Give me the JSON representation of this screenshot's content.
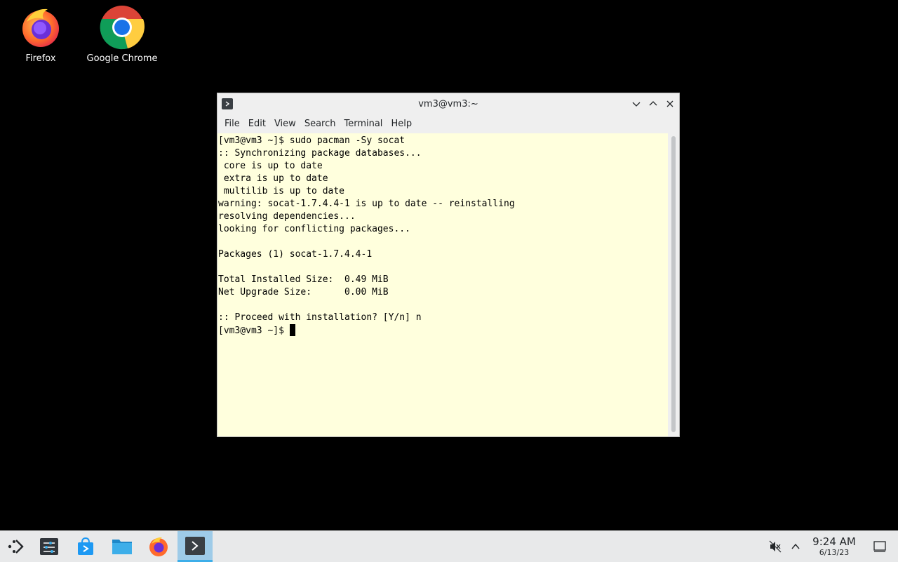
{
  "desktop": {
    "icons": [
      {
        "label": "Firefox",
        "icon": "firefox-icon"
      },
      {
        "label": "Google Chrome",
        "icon": "chrome-icon"
      }
    ]
  },
  "window": {
    "title": "vm3@vm3:~",
    "menu": [
      "File",
      "Edit",
      "View",
      "Search",
      "Terminal",
      "Help"
    ]
  },
  "terminal": {
    "lines": [
      "[vm3@vm3 ~]$ sudo pacman -Sy socat",
      ":: Synchronizing package databases...",
      " core is up to date",
      " extra is up to date",
      " multilib is up to date",
      "warning: socat-1.7.4.4-1 is up to date -- reinstalling",
      "resolving dependencies...",
      "looking for conflicting packages...",
      "",
      "Packages (1) socat-1.7.4.4-1",
      "",
      "Total Installed Size:  0.49 MiB",
      "Net Upgrade Size:      0.00 MiB",
      "",
      ":: Proceed with installation? [Y/n] n"
    ],
    "prompt": "[vm3@vm3 ~]$ "
  },
  "taskbar": {
    "items": [
      "app-launcher-icon",
      "system-settings-icon",
      "discover-icon",
      "file-manager-icon",
      "firefox-icon",
      "terminal-icon"
    ],
    "active": "terminal-icon",
    "tray": [
      "volume-muted-icon",
      "chevron-up-icon"
    ],
    "clock": {
      "time": "9:24 AM",
      "date": "6/13/23"
    }
  },
  "colors": {
    "terminal_bg": "#ffffdd",
    "active_task": "#9ecbe8",
    "accent": "#3daee9"
  }
}
